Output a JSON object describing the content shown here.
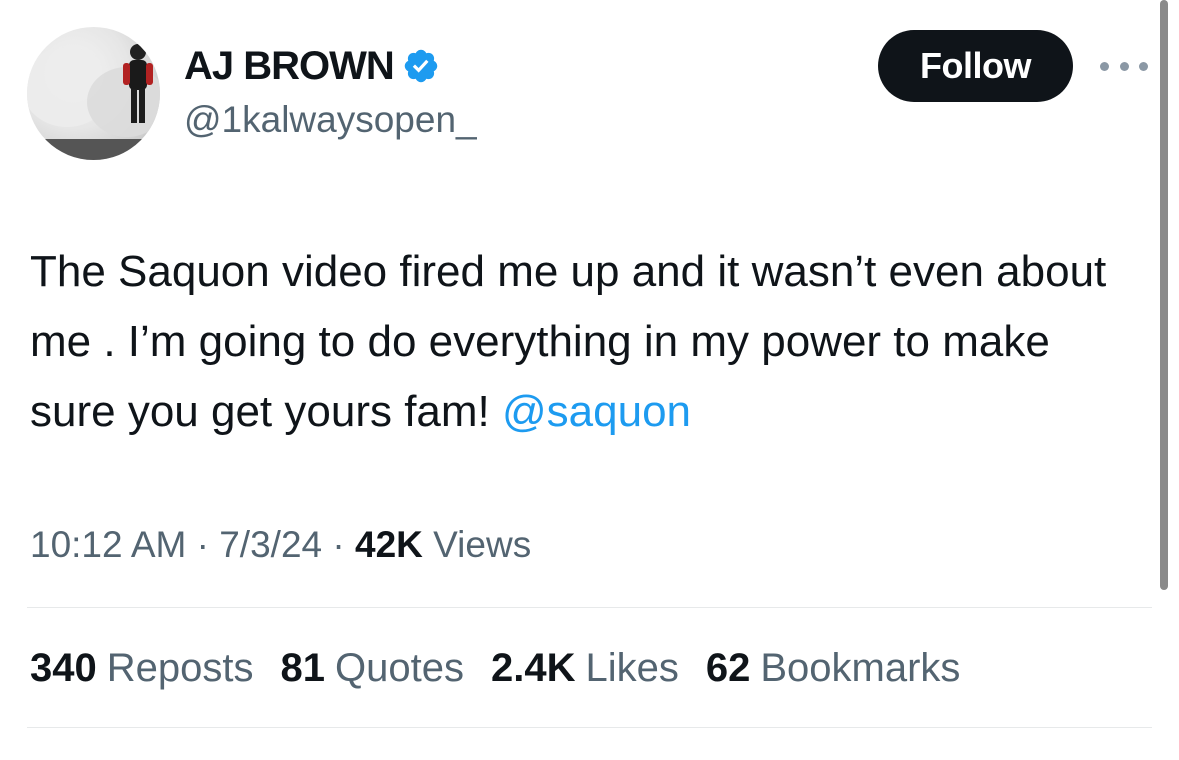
{
  "author": {
    "display_name": "AJ BROWN",
    "handle": "@1kalwaysopen_",
    "verified": true,
    "avatar_icon": "player-avatar"
  },
  "follow_button": {
    "label": "Follow"
  },
  "more_menu_icon": "more-horizontal-icon",
  "tweet": {
    "text_main": "The Saquon video fired me up and it wasn’t even about me .  I’m going to do everything in my power to make sure you get yours fam! ",
    "mention": "@saquon"
  },
  "meta": {
    "time": "10:12 AM",
    "separator": " · ",
    "date": "7/3/24",
    "views_count": "42K",
    "views_label": " Views"
  },
  "stats": [
    {
      "count": "340",
      "label": "Reposts"
    },
    {
      "count": "81",
      "label": "Quotes"
    },
    {
      "count": "2.4K",
      "label": "Likes"
    },
    {
      "count": "62",
      "label": "Bookmarks"
    }
  ],
  "colors": {
    "text": "#0f1419",
    "secondary": "#536471",
    "link": "#1d9bf0",
    "verified": "#1d9bf0",
    "button_bg": "#0f1419",
    "divider": "#e7e9ea"
  }
}
